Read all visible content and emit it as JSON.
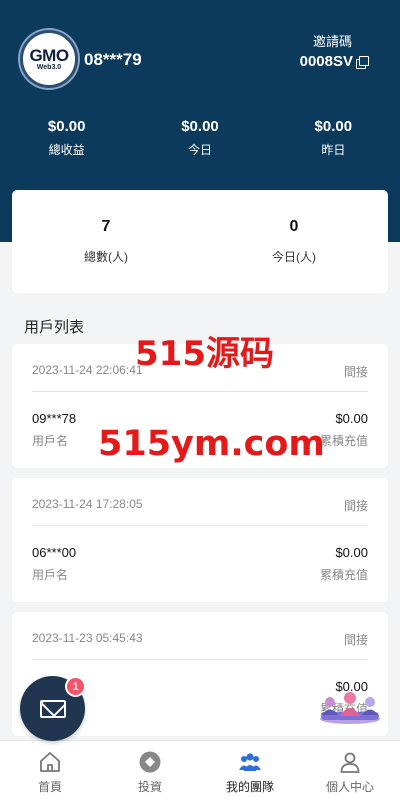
{
  "header": {
    "logo_text": "GMO",
    "logo_sub": "Web3.0",
    "username": "08***79",
    "invite_label": "邀請碼",
    "invite_code": "0008SV"
  },
  "earnings": [
    {
      "value": "$0.00",
      "label": "總收益"
    },
    {
      "value": "$0.00",
      "label": "今日"
    },
    {
      "value": "$0.00",
      "label": "昨日"
    }
  ],
  "team": [
    {
      "value": "7",
      "label": "總數(人)"
    },
    {
      "value": "0",
      "label": "今日(人)"
    }
  ],
  "section_title": "用戶列表",
  "users": [
    {
      "date": "2023-11-24 22:06:41",
      "type": "間接",
      "name": "09***78",
      "amount": "$0.00",
      "name_label": "用戶名",
      "amount_label": "累積充值"
    },
    {
      "date": "2023-11-24 17:28:05",
      "type": "間接",
      "name": "06***00",
      "amount": "$0.00",
      "name_label": "用戶名",
      "amount_label": "累積充值"
    },
    {
      "date": "2023-11-23 05:45:43",
      "type": "間接",
      "name": "",
      "amount": "$0.00",
      "name_label": "",
      "amount_label": "累積充值"
    }
  ],
  "watermarks": [
    "515源码",
    "515ym.com"
  ],
  "message_badge": "1",
  "tabs": [
    {
      "label": "首頁",
      "icon": "home-icon"
    },
    {
      "label": "投資",
      "icon": "invest-icon"
    },
    {
      "label": "我的團隊",
      "icon": "team-icon",
      "active": true
    },
    {
      "label": "個人中心",
      "icon": "profile-icon"
    }
  ],
  "colors": {
    "header": "#0c3a5c",
    "accent": "#2f6fdd",
    "badge": "#f25568",
    "watermark": "#e41a1a"
  }
}
